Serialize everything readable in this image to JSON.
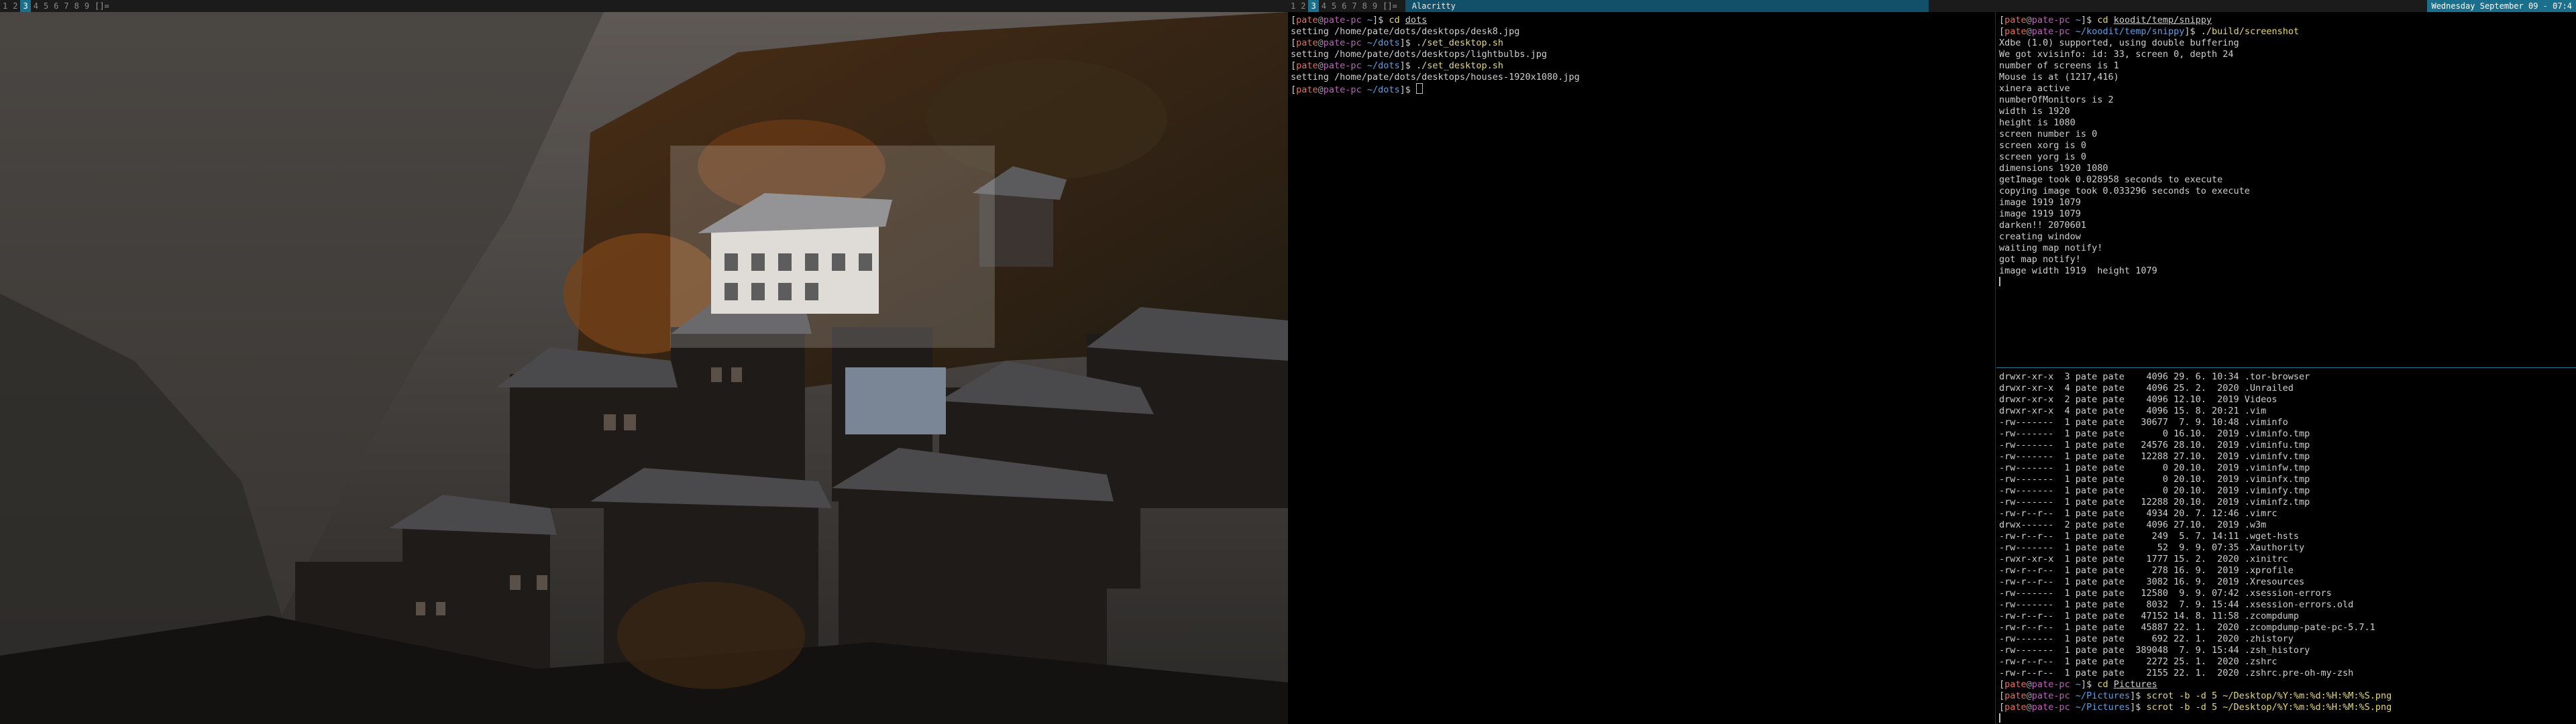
{
  "left_bar": {
    "workspaces": [
      "1",
      "2",
      "3",
      "4",
      "5",
      "6",
      "7",
      "8",
      "9"
    ],
    "active_index": 2,
    "layout": "[]="
  },
  "right_bar": {
    "workspaces": [
      "1",
      "2",
      "3",
      "4",
      "5",
      "6",
      "7",
      "8",
      "9"
    ],
    "active_index": 2,
    "layout": "[]=",
    "window_title": "Alacritty",
    "clock": "Wednesday September 09 - 07:4"
  },
  "term_left": {
    "lines": [
      {
        "prompt": {
          "user": "pate",
          "host": "pate-pc",
          "path": "~"
        },
        "cmd": "cd dots",
        "underline": "dots"
      },
      {
        "out": "setting /home/pate/dots/desktops/desk8.jpg"
      },
      {
        "prompt": {
          "user": "pate",
          "host": "pate-pc",
          "path": "~/dots"
        },
        "cmd": "./set_desktop.sh"
      },
      {
        "out": "setting /home/pate/dots/desktops/lightbulbs.jpg"
      },
      {
        "prompt": {
          "user": "pate",
          "host": "pate-pc",
          "path": "~/dots"
        },
        "cmd": "./set_desktop.sh"
      },
      {
        "out": "setting /home/pate/dots/desktops/houses-1920x1080.jpg"
      },
      {
        "prompt": {
          "user": "pate",
          "host": "pate-pc",
          "path": "~/dots"
        },
        "cmd": "",
        "cursor": true
      }
    ]
  },
  "term_top_right": {
    "lines": [
      {
        "prompt": {
          "user": "pate",
          "host": "pate-pc",
          "path": "~"
        },
        "cmd": "cd koodit/temp/snippy",
        "underline": "koodit/temp/snippy"
      },
      {
        "prompt": {
          "user": "pate",
          "host": "pate-pc",
          "path": "~/koodit/temp/snippy"
        },
        "cmd": "./build/screenshot"
      },
      {
        "out": "Xdbe (1.0) supported, using double buffering"
      },
      {
        "out": "We got xvisinfo: id: 33, screen 0, depth 24"
      },
      {
        "out": "number of screens is 1"
      },
      {
        "out": "Mouse is at (1217,416)"
      },
      {
        "out": "xinera active"
      },
      {
        "out": "numberOfMonitors is 2"
      },
      {
        "out": "width is 1920"
      },
      {
        "out": "height is 1080"
      },
      {
        "out": "screen number is 0"
      },
      {
        "out": "screen xorg is 0"
      },
      {
        "out": "screen yorg is 0"
      },
      {
        "out": "dimensions 1920 1080"
      },
      {
        "out": "getImage took 0.028958 seconds to execute"
      },
      {
        "out": "copying image took 0.033296 seconds to execute"
      },
      {
        "out": "image 1919 1079"
      },
      {
        "out": "image 1919 1079"
      },
      {
        "out": "darken!! 2070601"
      },
      {
        "out": "creating window"
      },
      {
        "out": "waiting map notify!"
      },
      {
        "out": "got map notify!"
      },
      {
        "out": "image width 1919  height 1079"
      },
      {
        "out": "",
        "cursor": true,
        "thin": true
      }
    ]
  },
  "term_bottom_right": {
    "lines": [
      {
        "out": "drwxr-xr-x  3 pate pate    4096 29. 6. 10:34 .tor-browser"
      },
      {
        "out": "drwxr-xr-x  4 pate pate    4096 25. 2.  2020 .Unrailed"
      },
      {
        "out": "drwxr-xr-x  2 pate pate    4096 12.10.  2019 Videos"
      },
      {
        "out": "drwxr-xr-x  4 pate pate    4096 15. 8. 20:21 .vim"
      },
      {
        "out": "-rw-------  1 pate pate   30677  7. 9. 10:48 .viminfo"
      },
      {
        "out": "-rw-------  1 pate pate       0 16.10.  2019 .viminfo.tmp"
      },
      {
        "out": "-rw-------  1 pate pate   24576 28.10.  2019 .viminfu.tmp"
      },
      {
        "out": "-rw-------  1 pate pate   12288 27.10.  2019 .viminfv.tmp"
      },
      {
        "out": "-rw-------  1 pate pate       0 20.10.  2019 .viminfw.tmp"
      },
      {
        "out": "-rw-------  1 pate pate       0 20.10.  2019 .viminfx.tmp"
      },
      {
        "out": "-rw-------  1 pate pate       0 20.10.  2019 .viminfy.tmp"
      },
      {
        "out": "-rw-------  1 pate pate   12288 20.10.  2019 .viminfz.tmp"
      },
      {
        "out": "-rw-r--r--  1 pate pate    4934 20. 7. 12:46 .vimrc"
      },
      {
        "out": "drwx------  2 pate pate    4096 27.10.  2019 .w3m"
      },
      {
        "out": "-rw-r--r--  1 pate pate     249  5. 7. 14:11 .wget-hsts"
      },
      {
        "out": "-rw-------  1 pate pate      52  9. 9. 07:35 .Xauthority"
      },
      {
        "out": "-rwxr-xr-x  1 pate pate    1777 15. 2.  2020 .xinitrc"
      },
      {
        "out": "-rw-r--r--  1 pate pate     278 16. 9.  2019 .xprofile"
      },
      {
        "out": "-rw-r--r--  1 pate pate    3082 16. 9.  2019 .Xresources"
      },
      {
        "out": "-rw-------  1 pate pate   12580  9. 9. 07:42 .xsession-errors"
      },
      {
        "out": "-rw-------  1 pate pate    8032  7. 9. 15:44 .xsession-errors.old"
      },
      {
        "out": "-rw-r--r--  1 pate pate   47152 14. 8. 11:58 .zcompdump"
      },
      {
        "out": "-rw-r--r--  1 pate pate   45887 22. 1.  2020 .zcompdump-pate-pc-5.7.1"
      },
      {
        "out": "-rw-------  1 pate pate     692 22. 1.  2020 .zhistory"
      },
      {
        "out": "-rw-------  1 pate pate  389048  7. 9. 15:44 .zsh_history"
      },
      {
        "out": "-rw-r--r--  1 pate pate    2272 25. 1.  2020 .zshrc"
      },
      {
        "out": "-rw-r--r--  1 pate pate    2155 22. 1.  2020 .zshrc.pre-oh-my-zsh"
      },
      {
        "prompt": {
          "user": "pate",
          "host": "pate-pc",
          "path": "~"
        },
        "cmd": "cd Pictures",
        "underline": "Pictures"
      },
      {
        "prompt": {
          "user": "pate",
          "host": "pate-pc",
          "path": "~/Pictures"
        },
        "cmd": "scrot -b -d 5 ~/Desktop/%Y:%m:%d:%H:%M:%S.png"
      },
      {
        "prompt": {
          "user": "pate",
          "host": "pate-pc",
          "path": "~/Pictures"
        },
        "cmd": "scrot -b -d 5 ~/Desktop/%Y:%m:%d:%H:%M:%S.png"
      },
      {
        "out": "",
        "cursor": true,
        "thin": true
      }
    ]
  },
  "colors": {
    "bar_bg": "#1b1b1b",
    "active_ws": "#1a6f8c",
    "title_bg": "#12506a",
    "user": "#e07060",
    "host": "#c060c0",
    "path": "#60a0e0",
    "command": "#e6d77a"
  }
}
